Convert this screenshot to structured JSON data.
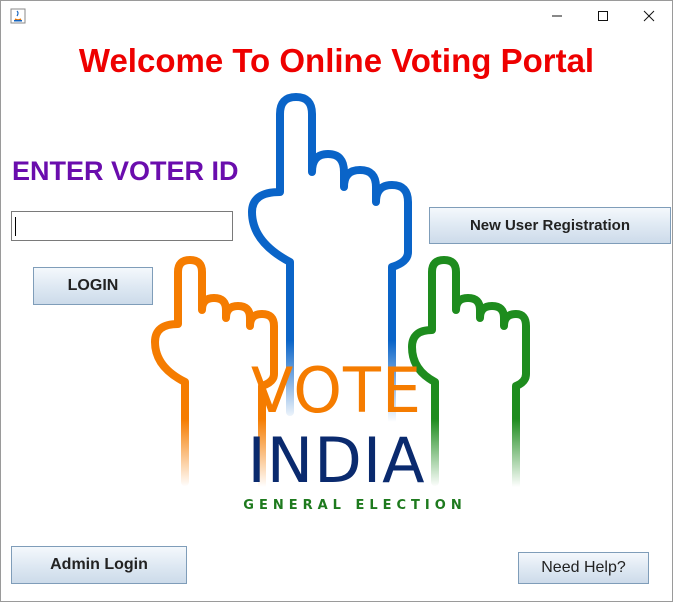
{
  "window": {
    "controls": {
      "minimize": "minimize-icon",
      "maximize": "maximize-icon",
      "close": "close-icon"
    }
  },
  "heading": "Welcome To Online Voting Portal",
  "voter_id_label": "ENTER VOTER ID",
  "voter_id_input": {
    "value": "",
    "placeholder": ""
  },
  "buttons": {
    "login": "LOGIN",
    "new_user": "New User Registration",
    "admin_login": "Admin Login",
    "need_help": "Need Help?"
  },
  "logo": {
    "line1": "VOTE",
    "line2": "INDIA",
    "line3": "GENERAL ELECTION",
    "colors": {
      "saffron": "#f57c00",
      "blue": "#0a64c8",
      "green": "#1e8c1e",
      "navy": "#0a2a6e"
    }
  },
  "colors": {
    "heading": "#ee0000",
    "label": "#6a0dad"
  }
}
